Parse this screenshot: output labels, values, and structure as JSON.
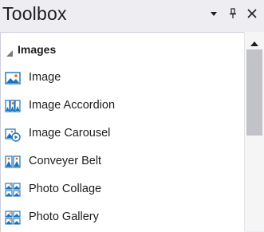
{
  "window": {
    "title": "Toolbox",
    "icons": {
      "dropdown": "chevron-down-icon",
      "pin": "pin-icon",
      "close": "close-icon"
    }
  },
  "group": {
    "label": "Images",
    "icon": "collapse-triangle-icon"
  },
  "items": [
    {
      "label": "Image",
      "icon": "image-icon"
    },
    {
      "label": "Image Accordion",
      "icon": "image-accordion-icon"
    },
    {
      "label": "Image Carousel",
      "icon": "image-carousel-icon"
    },
    {
      "label": "Conveyer Belt",
      "icon": "conveyer-belt-icon"
    },
    {
      "label": "Photo Collage",
      "icon": "photo-collage-icon"
    },
    {
      "label": "Photo Gallery",
      "icon": "photo-gallery-icon"
    }
  ],
  "colors": {
    "icon_blue": "#1b73ba",
    "icon_orange": "#e06c1f",
    "text": "#1e1e1e"
  }
}
